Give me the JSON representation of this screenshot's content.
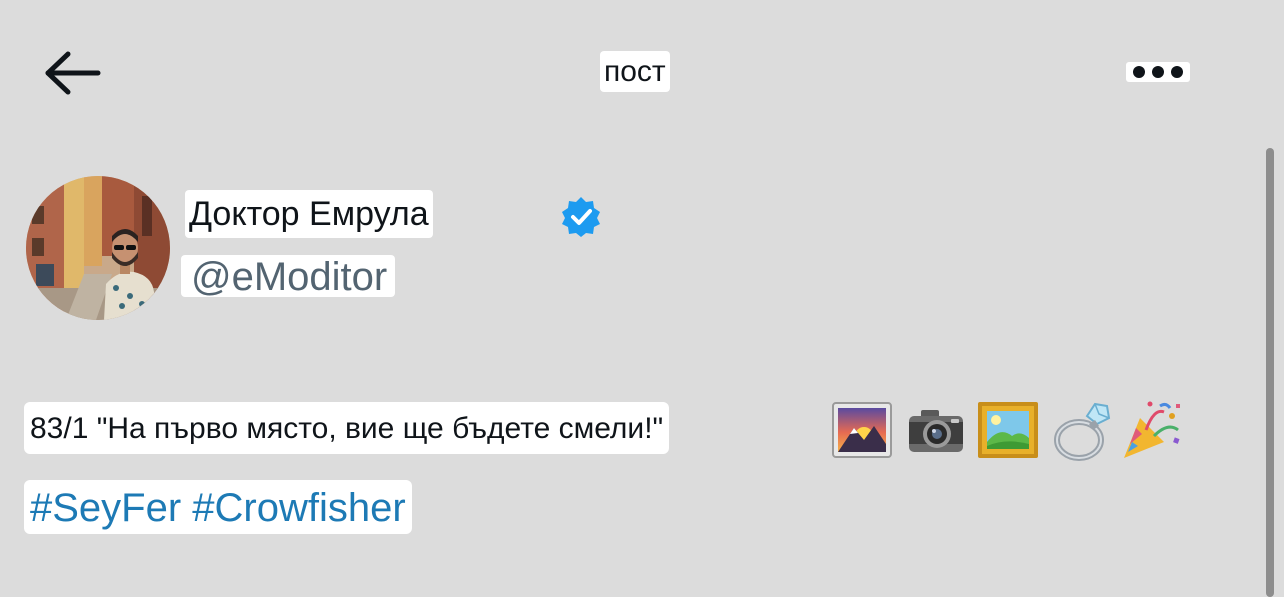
{
  "header": {
    "back_icon": "arrow-left-icon",
    "title": "пост",
    "more_icon": "more-horizontal-icon"
  },
  "author": {
    "display_name": "Доктор Емрула",
    "username": "@eModitor",
    "verified": true,
    "verified_icon": "verified-badge-icon",
    "verified_color": "#1d9bf0"
  },
  "post": {
    "text": "83/1 \"На първо място, вие ще бъдете смели!\"",
    "emojis": [
      "sunrise-over-mountains",
      "camera",
      "framed-picture",
      "ring",
      "party-popper"
    ],
    "hashtags": [
      "#SeyFer",
      "#Crowfisher"
    ],
    "hashtag_color": "#1d7ab5"
  },
  "colors": {
    "background": "#dcdcdc",
    "text_primary": "#0f1419",
    "text_secondary": "#536471"
  }
}
